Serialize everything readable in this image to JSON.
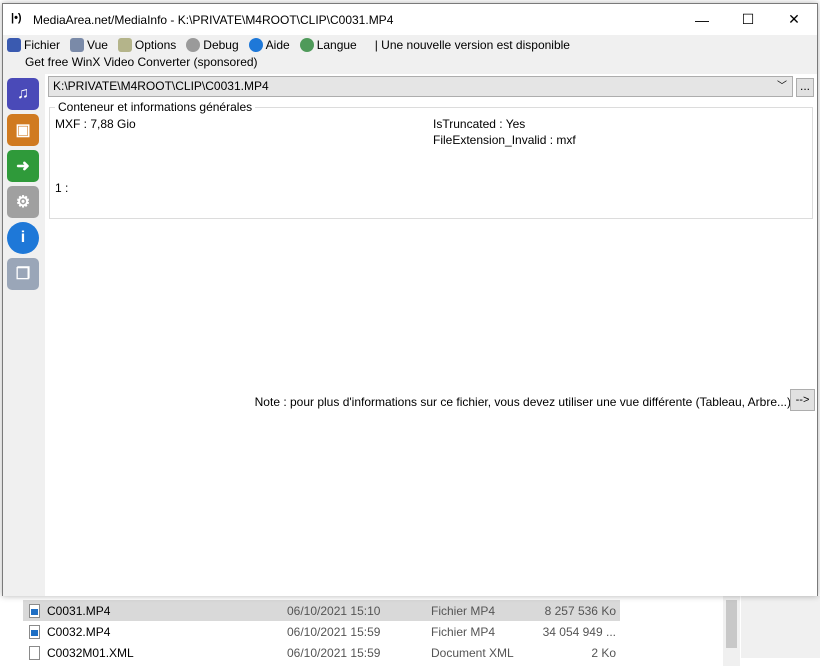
{
  "window": {
    "title": "MediaArea.net/MediaInfo - K:\\PRIVATE\\M4ROOT\\CLIP\\C0031.MP4",
    "minimize": "—",
    "maximize": "☐",
    "close": "✕"
  },
  "menu": [
    {
      "label": "Fichier",
      "color": "#3a5ab0"
    },
    {
      "label": "Vue",
      "color": "#7a8aa8"
    },
    {
      "label": "Options",
      "color": "#b4b48a"
    },
    {
      "label": "Debug",
      "color": "#9a9a9a"
    },
    {
      "label": "Aide",
      "color": "#1e78d8"
    },
    {
      "label": "Langue",
      "color": "#4f9a5a"
    }
  ],
  "update_notice": "| Une nouvelle version est disponible",
  "sponsor": "Get free WinX Video Converter (sponsored)",
  "file_path": "K:\\PRIVATE\\M4ROOT\\CLIP\\C0031.MP4",
  "browse_label": "...",
  "group": {
    "title": "Conteneur et informations générales",
    "format": "MXF : 7,88 Gio",
    "truncated": "IsTruncated : Yes",
    "ext_invalid": "FileExtension_Invalid : mxf",
    "stream": "1 :"
  },
  "note": "Note : pour plus d'informations sur ce fichier, vous devez utiliser une vue différente (Tableau, Arbre...)",
  "note_button": "-->",
  "files": [
    {
      "name": "C0031.MP4",
      "date": "06/10/2021 15:10",
      "type": "Fichier MP4",
      "size": "8 257 536 Ko"
    },
    {
      "name": "C0032.MP4",
      "date": "06/10/2021 15:59",
      "type": "Fichier MP4",
      "size": "34 054 949 ..."
    },
    {
      "name": "C0032M01.XML",
      "date": "06/10/2021 15:59",
      "type": "Document XML",
      "size": "2 Ko"
    }
  ]
}
